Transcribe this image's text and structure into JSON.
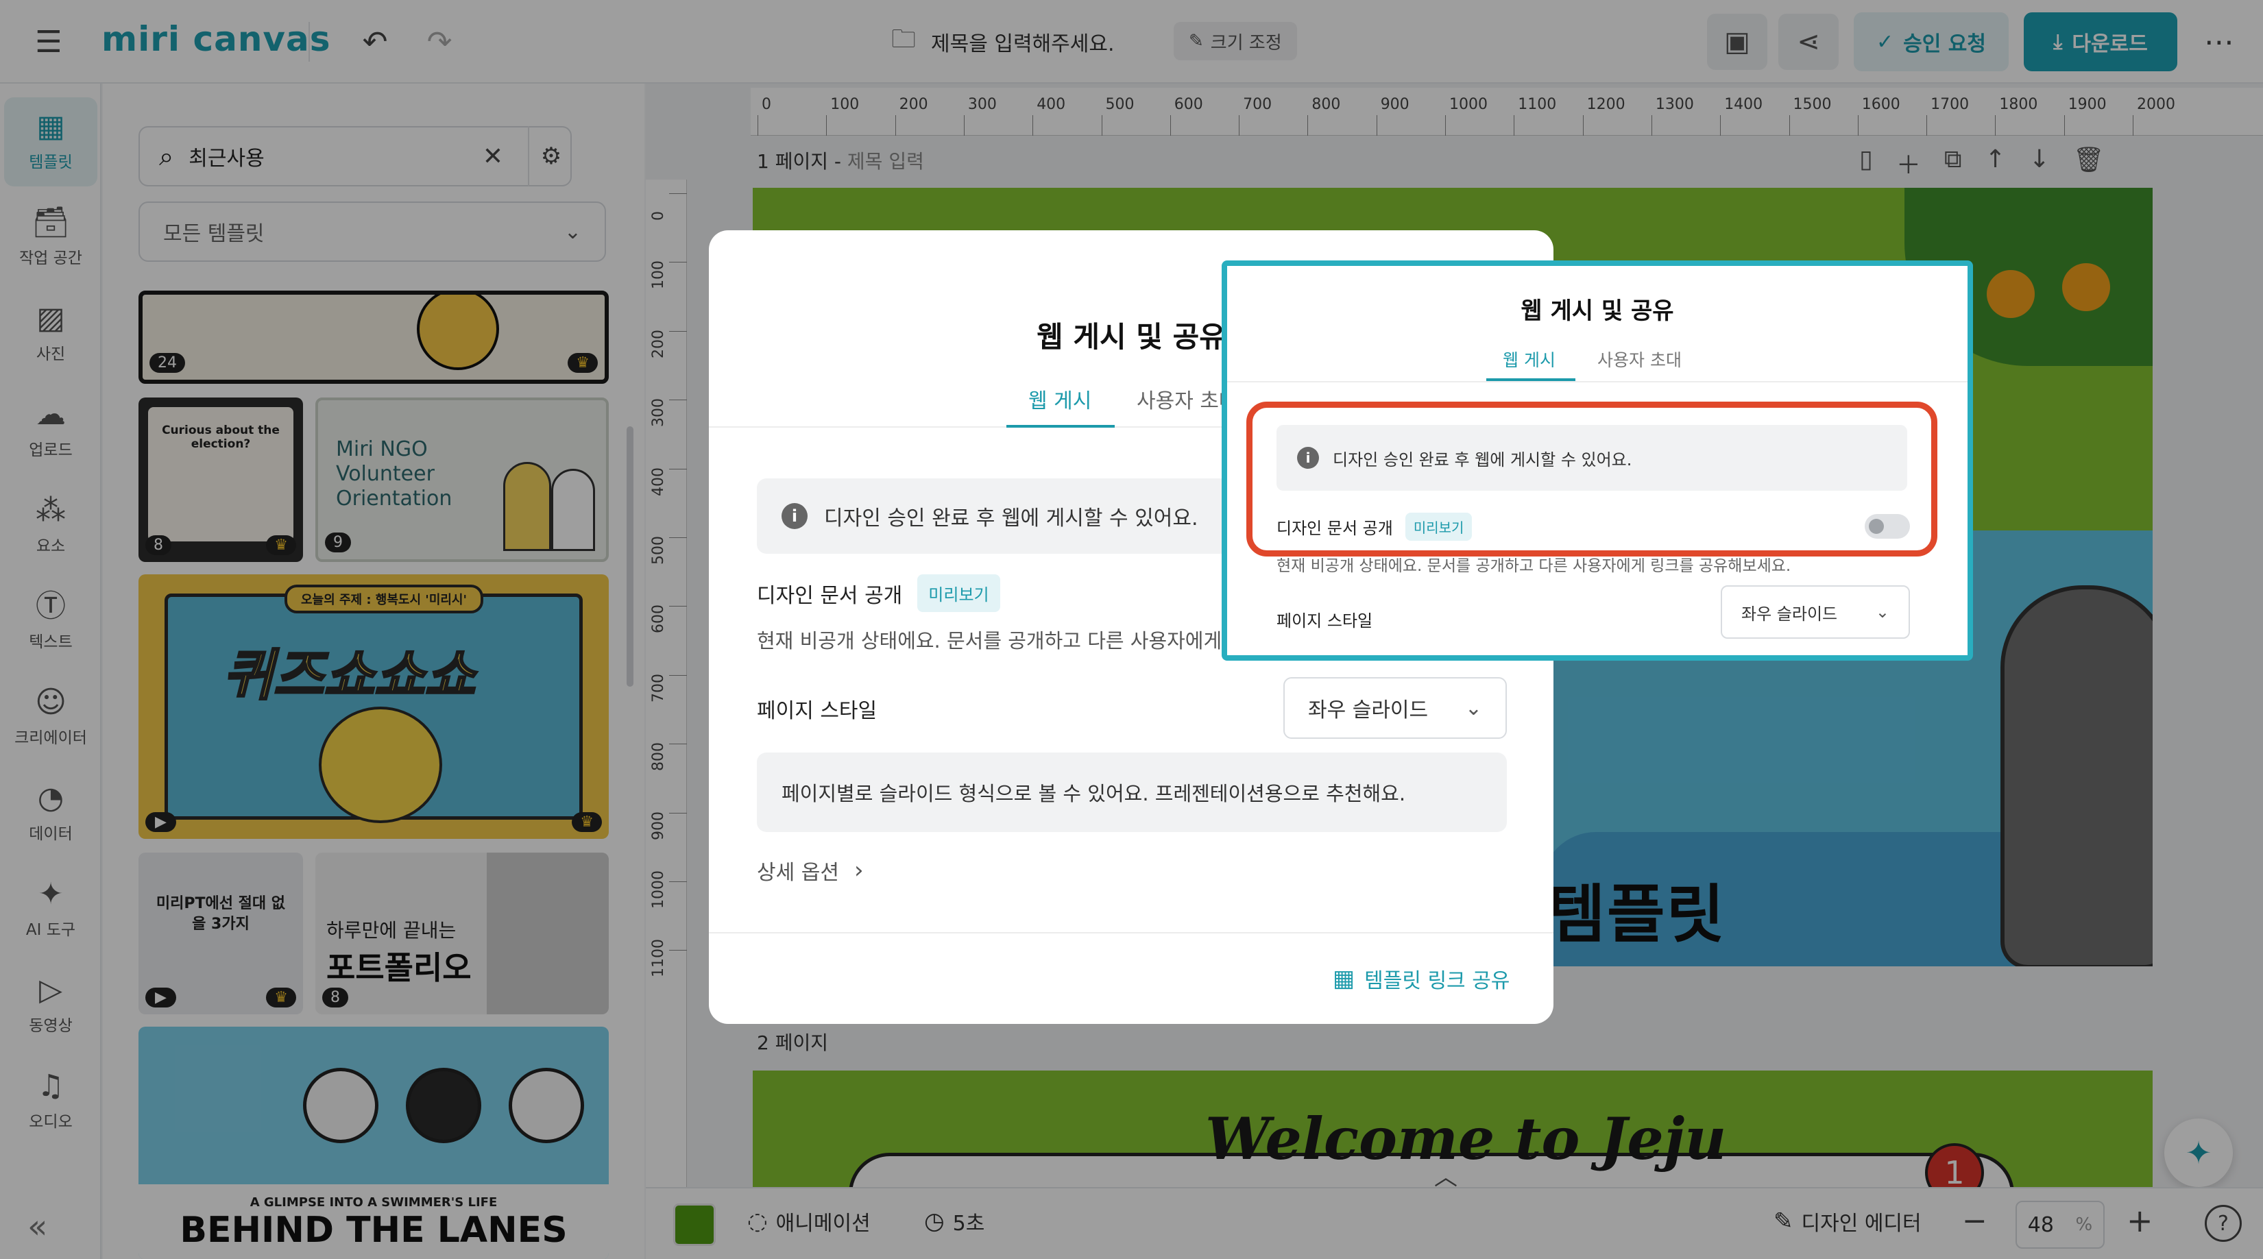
{
  "topbar": {
    "logo_text": "miri canvas",
    "doc_title_placeholder": "제목을 입력해주세요.",
    "resize_label": "크기 조정",
    "approve_label": "승인 요청",
    "download_label": "다운로드"
  },
  "rail": {
    "items": [
      {
        "label": "템플릿",
        "icon": "template-icon"
      },
      {
        "label": "작업 공간",
        "icon": "workspace-icon"
      },
      {
        "label": "사진",
        "icon": "photo-icon"
      },
      {
        "label": "업로드",
        "icon": "upload-icon"
      },
      {
        "label": "요소",
        "icon": "elements-icon"
      },
      {
        "label": "텍스트",
        "icon": "text-icon"
      },
      {
        "label": "크리에이터",
        "icon": "creator-icon"
      },
      {
        "label": "데이터",
        "icon": "data-icon"
      },
      {
        "label": "AI 도구",
        "icon": "ai-tools-icon"
      },
      {
        "label": "동영상",
        "icon": "video-icon"
      },
      {
        "label": "오디오",
        "icon": "audio-icon"
      }
    ]
  },
  "panel": {
    "search_value": "최근사용",
    "template_filter": "모든 템플릿",
    "thumbs": {
      "t1_num": "24",
      "t2_text": "Curious about the election?",
      "t2_num": "8",
      "t3_text": "Miri NGO Volunteer Orientation",
      "t3_num": "9",
      "t4_banner": "오늘의 주제 : 행복도시 '미리시'",
      "t4_title": "퀴즈쇼쇼쇼",
      "t5_text": "미리PT에선 절대 없을 3가지",
      "t6_line1": "하루만에 끝내는",
      "t6_line2": "포트폴리오",
      "t6_num": "8",
      "t7_sub": "A GLIMPSE INTO A SWIMMER'S LIFE",
      "t7_title": "BEHIND THE LANES"
    }
  },
  "canvas": {
    "ruler_h_labels": [
      "0",
      "100",
      "200",
      "300",
      "400",
      "500",
      "600",
      "700",
      "800",
      "900",
      "1000",
      "1100",
      "1200",
      "1300",
      "1400",
      "1500",
      "1600",
      "1700",
      "1800",
      "1900",
      "2000"
    ],
    "ruler_v_labels": [
      "0",
      "100",
      "200",
      "300",
      "400",
      "500",
      "600",
      "700",
      "800",
      "900",
      "1000",
      "1100"
    ],
    "page1_label": "1 페이지 - ",
    "page1_sub": "제목 입력",
    "slide1_headline": "좋은 템플릿",
    "page2_label": "2 페이지",
    "slide2_title": "Welcome to Jeju",
    "slide2_badge": "1"
  },
  "bottombar": {
    "color_swatch": "#4f9a13",
    "animation_label": "애니메이션",
    "duration_label": "5초",
    "editor_label": "디자인 에디터",
    "zoom_value": "48",
    "zoom_unit": "%"
  },
  "modal": {
    "title": "웹 게시 및 공유",
    "tabs": [
      "웹 게시",
      "사용자 초대"
    ],
    "notice": "디자인 승인 완료 후 웹에 게시할 수 있어요.",
    "public_label": "디자인 문서 공개",
    "preview_chip": "미리보기",
    "public_desc": "현재 비공개 상태에요. 문서를 공개하고 다른 사용자에게",
    "pagestyle_label": "페이지 스타일",
    "pagestyle_value": "좌우 슬라이드",
    "slide_desc": "페이지별로 슬라이드 형식으로 볼 수 있어요. 프레젠테이션용으로 추천해요.",
    "detail_options": "상세 옵션",
    "share_link": "템플릿 링크 공유"
  },
  "zoom_callout": {
    "title": "웹 게시 및 공유",
    "tabs": [
      "웹 게시",
      "사용자 초대"
    ],
    "notice": "디자인 승인 완료 후 웹에 게시할 수 있어요.",
    "public_label": "디자인 문서 공개",
    "preview_chip": "미리보기",
    "toggle_on": false,
    "public_desc": "현재 비공개 상태에요. 문서를 공개하고 다른 사용자에게 링크를 공유해보세요.",
    "pagestyle_label": "페이지 스타일",
    "pagestyle_value": "좌우 슬라이드"
  },
  "colors": {
    "accent": "#1ea0b4",
    "highlight_red": "#e0482b",
    "callout_border": "#29aebf",
    "slide_green": "#85c231"
  }
}
